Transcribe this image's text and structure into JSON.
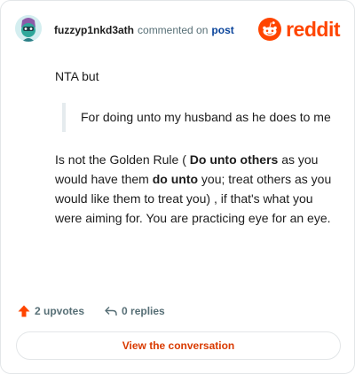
{
  "comment": {
    "username": "fuzzyp1nkd3ath",
    "action_text": "commented on",
    "post_link": "post",
    "paragraphs": {
      "first": "NTA but",
      "quote": "For doing unto my husband as he does to me",
      "last": {
        "part1": "Is not the Golden Rule ( ",
        "bold1": "Do unto others",
        "part2": " as you would have them ",
        "bold2": "do unto",
        "part3": " you; treat others as you would like them to treat you) , if that's what you were aiming for. You are practicing eye for an eye."
      }
    }
  },
  "brand": {
    "wordmark": "reddit",
    "color": "#ff4500"
  },
  "actions": {
    "upvotes": "2 upvotes",
    "replies": "0 replies"
  },
  "cta": {
    "label": "View the conversation"
  },
  "icons": {
    "avatar": "avatar-illustration",
    "brand": "reddit-snoo-icon",
    "upvote": "upvote-arrow-icon",
    "reply": "reply-arrow-icon"
  },
  "colors": {
    "accent": "#ff4500",
    "link": "#0a449b",
    "muted": "#576f76",
    "cta_text": "#d93a00"
  }
}
